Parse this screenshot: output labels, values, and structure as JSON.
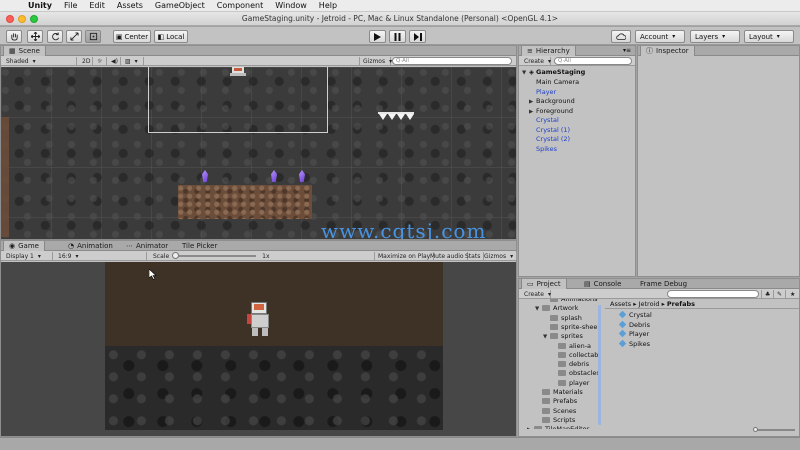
{
  "menubar": {
    "app": "Unity",
    "items": [
      "File",
      "Edit",
      "Assets",
      "GameObject",
      "Component",
      "Window",
      "Help"
    ]
  },
  "window": {
    "title": "GameStaging.unity - Jetroid - PC, Mac & Linux Standalone (Personal) <OpenGL 4.1>"
  },
  "toolbar": {
    "pivot_label": "Center",
    "space_label": "Local",
    "account_label": "Account",
    "layers_label": "Layers",
    "layout_label": "Layout"
  },
  "scene": {
    "tab": "Scene",
    "shading": "Shaded",
    "mode_2d": "2D",
    "gizmos": "Gizmos",
    "search_placeholder": "Q·All"
  },
  "game": {
    "tabs": [
      "Game",
      "Animation",
      "Animator",
      "Tile Picker"
    ],
    "display": "Display 1",
    "aspect": "16:9",
    "scale_label": "Scale",
    "scale_value": "1x",
    "toggles": [
      "Maximize on Play",
      "Mute audio",
      "Stats",
      "Gizmos"
    ]
  },
  "hierarchy": {
    "tab": "Hierarchy",
    "create": "Create",
    "search_placeholder": "Q·All",
    "scene_name": "GameStaging",
    "items": [
      {
        "label": "Main Camera",
        "blue": false,
        "expandable": false
      },
      {
        "label": "Player",
        "blue": true,
        "expandable": false
      },
      {
        "label": "Background",
        "blue": false,
        "expandable": true
      },
      {
        "label": "Foreground",
        "blue": false,
        "expandable": true
      },
      {
        "label": "Crystal",
        "blue": true,
        "expandable": false
      },
      {
        "label": "Crystal (1)",
        "blue": true,
        "expandable": false
      },
      {
        "label": "Crystal (2)",
        "blue": true,
        "expandable": false
      },
      {
        "label": "Spikes",
        "blue": true,
        "expandable": false
      }
    ]
  },
  "inspector": {
    "tab": "Inspector"
  },
  "project": {
    "tabs": [
      "Project",
      "Console",
      "Frame Debug"
    ],
    "create": "Create",
    "breadcrumb": [
      "Assets",
      "Jetroid",
      "Prefabs"
    ],
    "tree": [
      {
        "label": "Animations",
        "indent": 2,
        "arrow": ""
      },
      {
        "label": "Artwork",
        "indent": 1,
        "arrow": "▼"
      },
      {
        "label": "splash",
        "indent": 2,
        "arrow": ""
      },
      {
        "label": "sprite-shee",
        "indent": 2,
        "arrow": ""
      },
      {
        "label": "sprites",
        "indent": 2,
        "arrow": "▼"
      },
      {
        "label": "alien-a",
        "indent": 3,
        "arrow": ""
      },
      {
        "label": "collectab",
        "indent": 3,
        "arrow": ""
      },
      {
        "label": "debris",
        "indent": 3,
        "arrow": ""
      },
      {
        "label": "obstacles",
        "indent": 3,
        "arrow": ""
      },
      {
        "label": "player",
        "indent": 3,
        "arrow": ""
      },
      {
        "label": "Materials",
        "indent": 1,
        "arrow": ""
      },
      {
        "label": "Prefabs",
        "indent": 1,
        "arrow": ""
      },
      {
        "label": "Scenes",
        "indent": 1,
        "arrow": ""
      },
      {
        "label": "Scripts",
        "indent": 1,
        "arrow": ""
      },
      {
        "label": "TileMapEditor",
        "indent": 0,
        "arrow": "▶"
      }
    ],
    "assets": [
      "Crystal",
      "Debris",
      "Player",
      "Spikes"
    ]
  },
  "watermark": "www.cgtsj.com",
  "colors": {
    "accent_blue": "#1f3fc8",
    "crystal": "#8a5cf0",
    "dirt": "#6b4d3a"
  }
}
